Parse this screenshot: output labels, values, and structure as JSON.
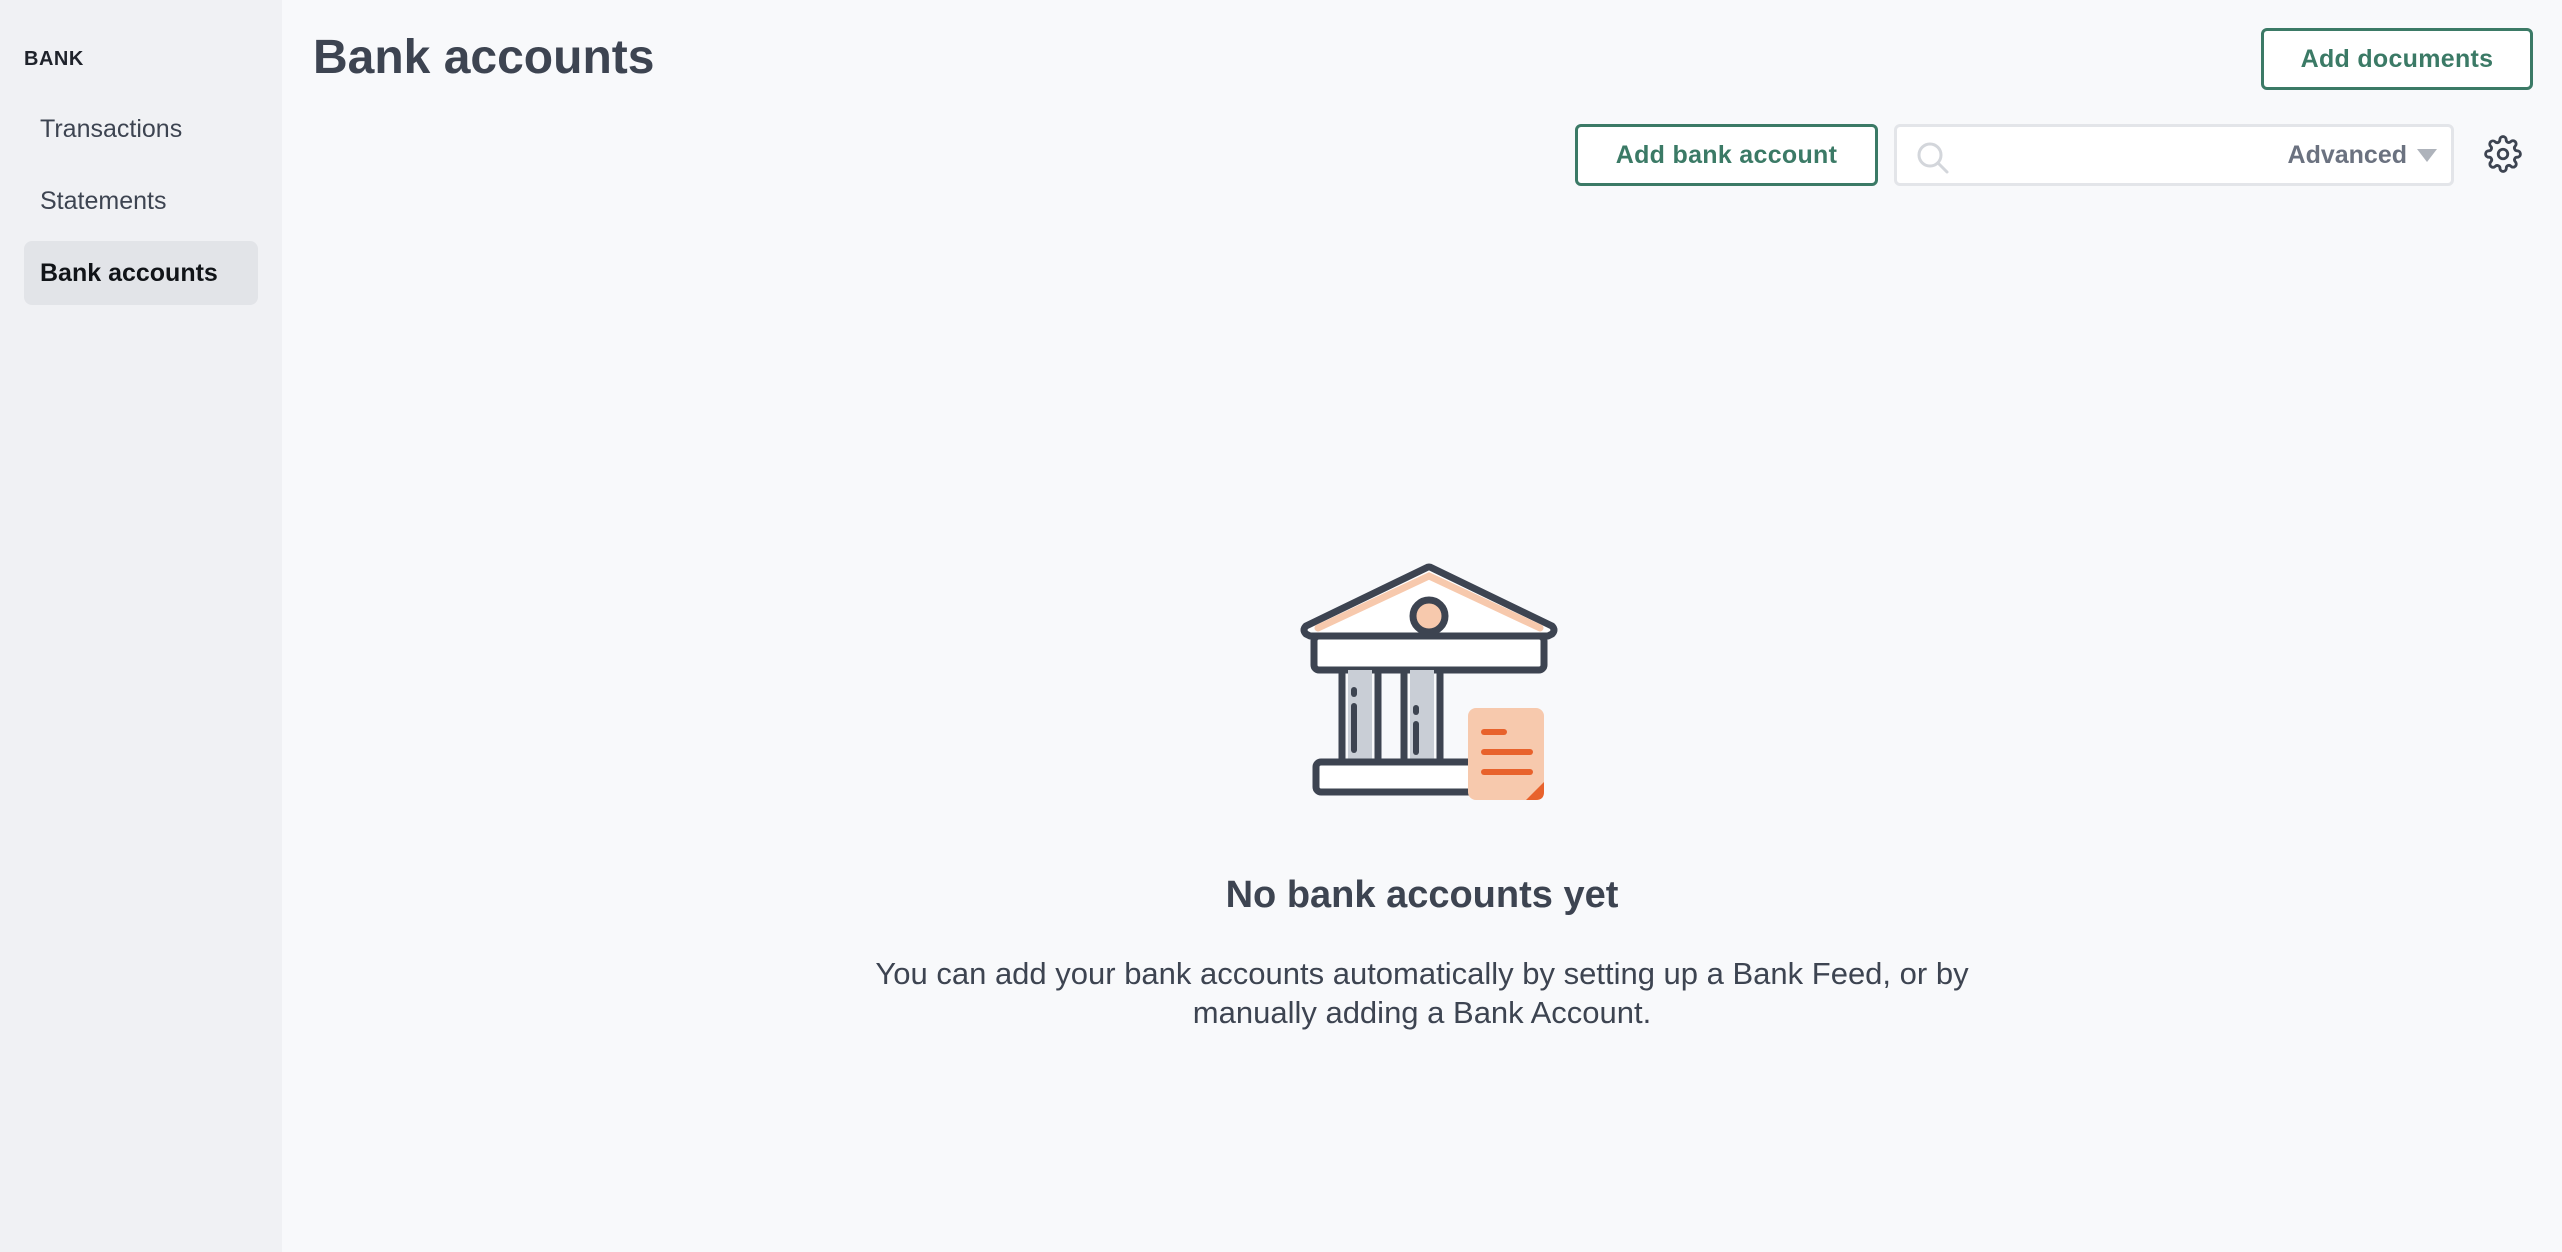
{
  "sidebar": {
    "heading": "BANK",
    "items": [
      {
        "label": "Transactions",
        "active": false
      },
      {
        "label": "Statements",
        "active": false
      },
      {
        "label": "Bank accounts",
        "active": true
      }
    ]
  },
  "header": {
    "title": "Bank accounts",
    "add_documents_label": "Add documents"
  },
  "toolbar": {
    "add_bank_account_label": "Add bank account",
    "search": {
      "value": "",
      "placeholder": ""
    },
    "advanced_label": "Advanced"
  },
  "empty_state": {
    "title": "No bank accounts yet",
    "description": "You can add your bank accounts automatically by setting up a Bank Feed, or by manually adding a Bank Account."
  },
  "icons": {
    "search": "search-icon",
    "settings": "gear-icon",
    "dropdown": "caret-down-icon",
    "illustration": "bank-building-illustration"
  },
  "colors": {
    "accent": "#3b7a66",
    "text": "#3d4451",
    "sidebar_bg": "#f0f1f4",
    "main_bg": "#f8f9fb",
    "illustration_peach": "#f7c9ad",
    "illustration_orange": "#e8622c"
  }
}
